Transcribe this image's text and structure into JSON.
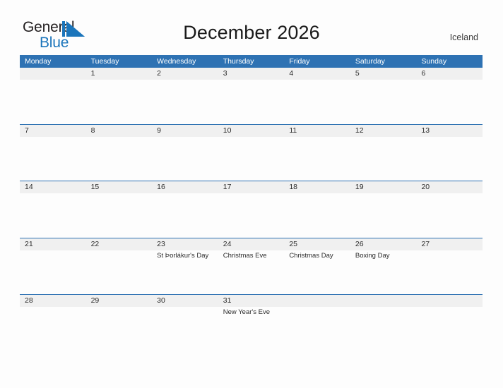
{
  "brand": {
    "name_part1": "General",
    "name_part2": "Blue",
    "flag_color": "#1b75bb"
  },
  "header": {
    "title": "December 2026",
    "region": "Iceland"
  },
  "theme": {
    "header_blue": "#2e72b3",
    "band_gray": "#f0f0f0",
    "page_background": "#fdfdfd",
    "text_color": "#2b2b2b"
  },
  "calendar": {
    "weekdays": [
      "Monday",
      "Tuesday",
      "Wednesday",
      "Thursday",
      "Friday",
      "Saturday",
      "Sunday"
    ],
    "weeks": [
      [
        {
          "day": "",
          "events": []
        },
        {
          "day": "1",
          "events": []
        },
        {
          "day": "2",
          "events": []
        },
        {
          "day": "3",
          "events": []
        },
        {
          "day": "4",
          "events": []
        },
        {
          "day": "5",
          "events": []
        },
        {
          "day": "6",
          "events": []
        }
      ],
      [
        {
          "day": "7",
          "events": []
        },
        {
          "day": "8",
          "events": []
        },
        {
          "day": "9",
          "events": []
        },
        {
          "day": "10",
          "events": []
        },
        {
          "day": "11",
          "events": []
        },
        {
          "day": "12",
          "events": []
        },
        {
          "day": "13",
          "events": []
        }
      ],
      [
        {
          "day": "14",
          "events": []
        },
        {
          "day": "15",
          "events": []
        },
        {
          "day": "16",
          "events": []
        },
        {
          "day": "17",
          "events": []
        },
        {
          "day": "18",
          "events": []
        },
        {
          "day": "19",
          "events": []
        },
        {
          "day": "20",
          "events": []
        }
      ],
      [
        {
          "day": "21",
          "events": []
        },
        {
          "day": "22",
          "events": []
        },
        {
          "day": "23",
          "events": [
            "St Þorlákur's Day"
          ]
        },
        {
          "day": "24",
          "events": [
            "Christmas Eve"
          ]
        },
        {
          "day": "25",
          "events": [
            "Christmas Day"
          ]
        },
        {
          "day": "26",
          "events": [
            "Boxing Day"
          ]
        },
        {
          "day": "27",
          "events": []
        }
      ],
      [
        {
          "day": "28",
          "events": []
        },
        {
          "day": "29",
          "events": []
        },
        {
          "day": "30",
          "events": []
        },
        {
          "day": "31",
          "events": [
            "New Year's Eve"
          ]
        },
        {
          "day": "",
          "events": []
        },
        {
          "day": "",
          "events": []
        },
        {
          "day": "",
          "events": []
        }
      ]
    ]
  }
}
